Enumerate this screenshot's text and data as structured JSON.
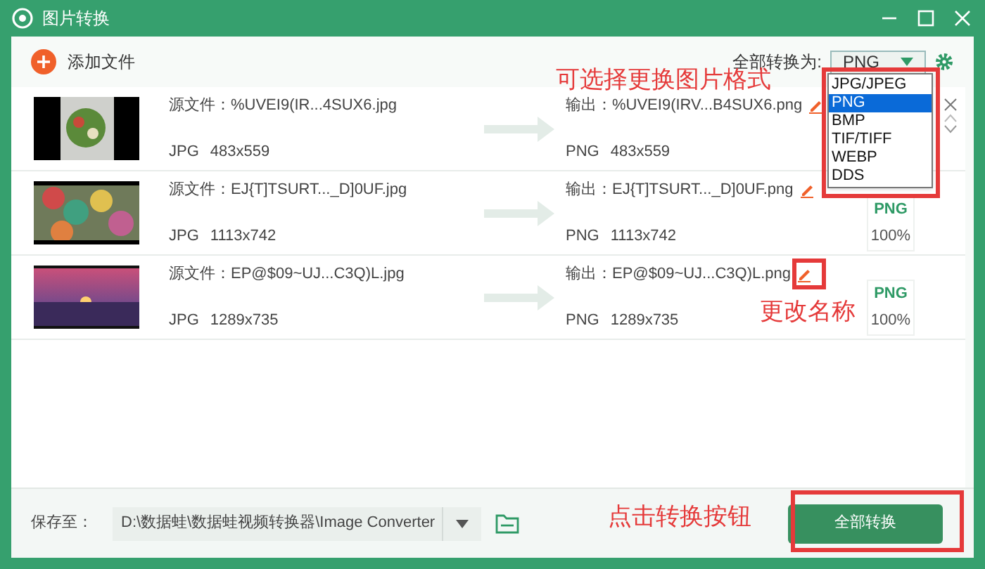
{
  "window": {
    "title": "图片转换"
  },
  "toolbar": {
    "add_file": "添加文件",
    "convert_all_label": "全部转换为:",
    "format_select": "PNG",
    "format_options": [
      {
        "label": "JPG/JPEG",
        "selected": false
      },
      {
        "label": "PNG",
        "selected": true
      },
      {
        "label": "BMP",
        "selected": false
      },
      {
        "label": "TIF/TIFF",
        "selected": false
      },
      {
        "label": "WEBP",
        "selected": false
      },
      {
        "label": "DDS",
        "selected": false
      }
    ]
  },
  "files": [
    {
      "source": "源文件：%UVEI9(IR...4SUX6.jpg",
      "source_format": "JPG",
      "source_size": "483x559",
      "output": "输出：%UVEI9(IRV...B4SUX6.png",
      "output_format": "PNG",
      "output_size": "483x559",
      "row_controls": true
    },
    {
      "source": "源文件：EJ{T]TSURT..._D]0UF.jpg",
      "source_format": "JPG",
      "source_size": "1113x742",
      "output": "输出：EJ{T]TSURT..._D]0UF.png",
      "output_format": "PNG",
      "output_size": "1113x742",
      "badge": {
        "format": "PNG",
        "percent": "100%"
      },
      "row_controls": false
    },
    {
      "source": "源文件：EP@$09~UJ...C3Q)L.jpg",
      "source_format": "JPG",
      "source_size": "1289x735",
      "output": "输出：EP@$09~UJ...C3Q)L.png",
      "output_format": "PNG",
      "output_size": "1289x735",
      "badge": {
        "format": "PNG",
        "percent": "100%"
      },
      "row_controls": false
    }
  ],
  "annotations": [
    {
      "kind": "format",
      "text": "可选择更换图片格式"
    },
    {
      "kind": "rename",
      "text": "更改名称"
    },
    {
      "kind": "convert",
      "text": "点击转换按钮"
    }
  ],
  "save_bar": {
    "label": "保存至：",
    "path": "D:\\数据蛙\\数据蛙视频转换器\\Image Converter",
    "button": "全部转换"
  }
}
